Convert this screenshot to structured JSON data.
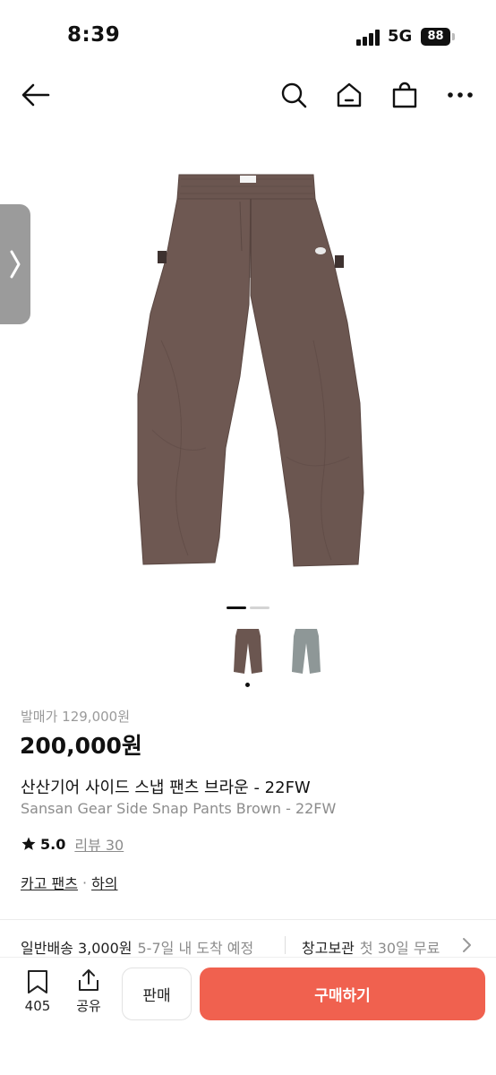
{
  "status_bar": {
    "time": "8:39",
    "network": "5G",
    "battery": "88"
  },
  "header": {
    "back_icon": "arrow-left-icon",
    "search_icon": "search-icon",
    "home_icon": "home-icon",
    "bag_icon": "shopping-bag-icon",
    "more_icon": "more-horizontal-icon"
  },
  "gallery": {
    "active_index": 0,
    "total": 2,
    "thumbnails": [
      {
        "name": "brown-pants-thumbnail",
        "color": "#6b5650"
      },
      {
        "name": "gray-pants-thumbnail",
        "color": "#8e9797"
      }
    ]
  },
  "product": {
    "original_price": "발매가 129,000원",
    "price": "200,000원",
    "title_ko": "산산기어 사이드 스냅 팬츠 브라운 - 22FW",
    "title_en": "Sansan Gear Side Snap Pants Brown - 22FW",
    "rating": "5.0",
    "review_label": "리뷰 30",
    "categories": [
      "카고 팬츠",
      "하의"
    ],
    "category_sep": "·"
  },
  "shipping": {
    "label": "일반배송 3,000원",
    "eta": "5-7일 내 도착 예정",
    "storage_label": "창고보관",
    "storage_note": "첫 30일 무료"
  },
  "bottom_bar": {
    "wishlist_count": "405",
    "share_label": "공유",
    "sell_label": "판매",
    "buy_label": "구매하기"
  },
  "colors": {
    "accent": "#f0614f",
    "product_brown": "#6b5650"
  }
}
